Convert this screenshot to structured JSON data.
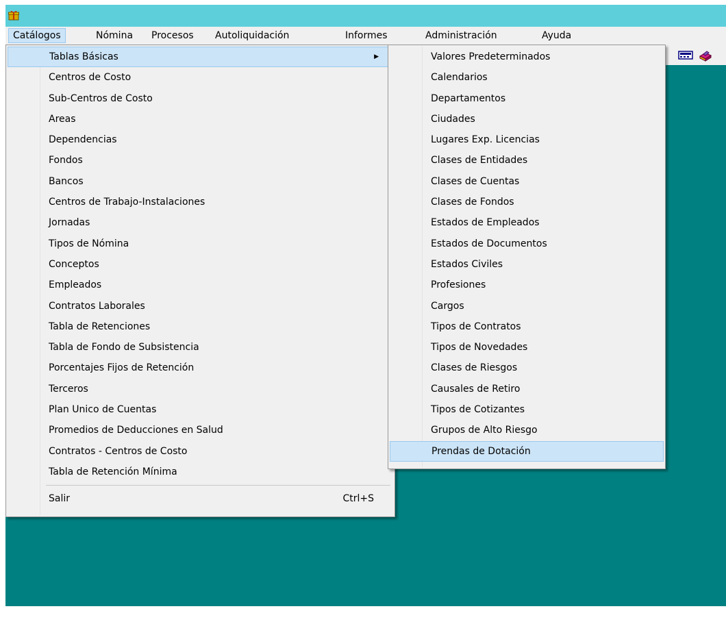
{
  "menubar": {
    "items": [
      "Catálogos",
      "Nómina",
      "Procesos",
      "Autoliquidación",
      "Informes",
      "Administración",
      "Ayuda"
    ]
  },
  "icons": {
    "app": "gift-icon",
    "toolbar": [
      "calculator-icon",
      "book-icon"
    ]
  },
  "catalogos_menu": {
    "items": [
      {
        "label": "Tablas Básicas",
        "has_submenu": true
      },
      {
        "label": "Centros de Costo"
      },
      {
        "label": "Sub-Centros de Costo"
      },
      {
        "label": "Areas"
      },
      {
        "label": "Dependencias"
      },
      {
        "label": "Fondos"
      },
      {
        "label": "Bancos"
      },
      {
        "label": "Centros de Trabajo-Instalaciones"
      },
      {
        "label": "Jornadas"
      },
      {
        "label": "Tipos de Nómina"
      },
      {
        "label": "Conceptos"
      },
      {
        "label": "Empleados"
      },
      {
        "label": "Contratos Laborales"
      },
      {
        "label": "Tabla de Retenciones"
      },
      {
        "label": "Tabla de Fondo de Subsistencia"
      },
      {
        "label": "Porcentajes Fijos de Retención"
      },
      {
        "label": "Terceros"
      },
      {
        "label": "Plan Unico de Cuentas"
      },
      {
        "label": "Promedios de Deducciones en Salud"
      },
      {
        "label": "Contratos - Centros de Costo"
      },
      {
        "label": "Tabla de Retención Mínima"
      }
    ],
    "exit": {
      "label": "Salir",
      "shortcut": "Ctrl+S"
    }
  },
  "tablas_basicas_submenu": {
    "items": [
      "Valores Predeterminados",
      "Calendarios",
      "Departamentos",
      "Ciudades",
      "Lugares Exp. Licencias",
      "Clases de Entidades",
      "Clases de Cuentas",
      "Clases de Fondos",
      "Estados de Empleados",
      "Estados de Documentos",
      "Estados Civiles",
      "Profesiones",
      "Cargos",
      "Tipos de Contratos",
      "Tipos de Novedades",
      "Clases de Riesgos",
      "Causales de Retiro",
      "Tipos de Cotizantes",
      "Grupos de Alto Riesgo",
      "Prendas de Dotación"
    ]
  },
  "colors": {
    "title_bar": "#5dcfda",
    "desktop": "#008080",
    "menu_bg": "#f0f0f0",
    "highlight": "#cce4f7"
  }
}
